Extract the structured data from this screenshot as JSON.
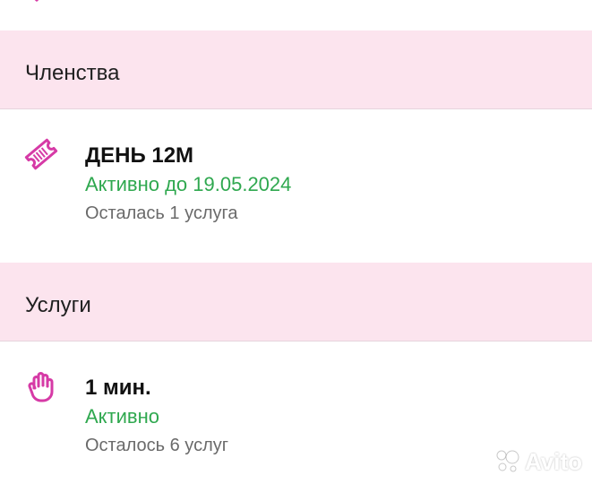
{
  "sections": {
    "memberships": {
      "title": "Членства",
      "item": {
        "icon": "ticket-icon",
        "title": "ДЕНЬ 12М",
        "status": "Активно до 19.05.2024",
        "remaining": "Осталась 1 услуга"
      }
    },
    "services": {
      "title": "Услуги",
      "item": {
        "icon": "hand-icon",
        "title": "1 мин.",
        "status": "Активно",
        "remaining": "Осталось 6 услуг"
      }
    }
  },
  "watermark": {
    "text": "Avito"
  },
  "colors": {
    "accent": "#d63aa6",
    "header_bg": "#fce4ee",
    "status_green": "#2fa84f",
    "muted_text": "#6a6a6a"
  }
}
